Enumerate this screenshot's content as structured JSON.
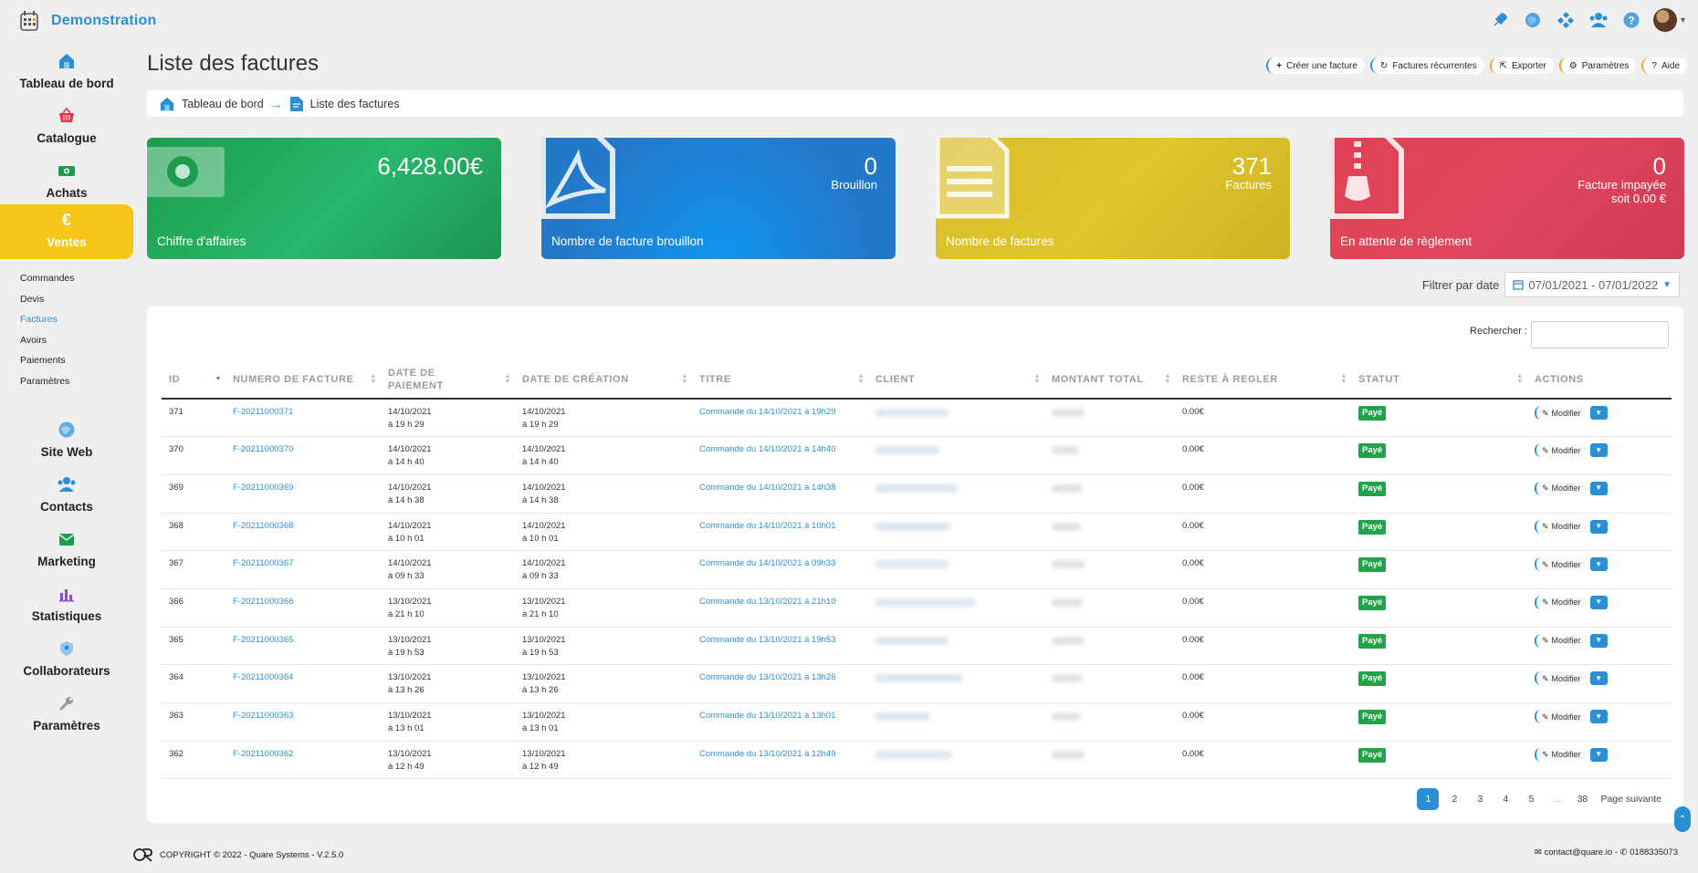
{
  "app": {
    "name": "Demonstration"
  },
  "colors": {
    "accent": "#2b8fd6",
    "active_nav": "#f5c518",
    "paid": "#22a34a"
  },
  "top_icons": [
    "rocket-icon",
    "globe-icon",
    "tasks-icon",
    "users-icon",
    "help-icon"
  ],
  "sidebar": {
    "items": [
      {
        "label": "Tableau de bord",
        "icon": "home-icon"
      },
      {
        "label": "Catalogue",
        "icon": "basket-icon"
      },
      {
        "label": "Achats",
        "icon": "cash-icon"
      },
      {
        "label": "Ventes",
        "icon": "euro-icon"
      },
      {
        "label": "Site Web",
        "icon": "globe-icon"
      },
      {
        "label": "Contacts",
        "icon": "contacts-icon"
      },
      {
        "label": "Marketing",
        "icon": "mail-icon"
      },
      {
        "label": "Statistiques",
        "icon": "stats-icon"
      },
      {
        "label": "Collaborateurs",
        "icon": "shield-icon"
      },
      {
        "label": "Paramètres",
        "icon": "wrench-icon"
      }
    ],
    "subnav": [
      "Commandes",
      "Devis",
      "Factures",
      "Avoirs",
      "Paiements",
      "Paramètres"
    ]
  },
  "page": {
    "title": "Liste des factures"
  },
  "actions": [
    "Créer une facture",
    "Factures récurrentes",
    "Exporter",
    "Paramètres",
    "Aide"
  ],
  "breadcrumb": {
    "home": "Tableau de bord",
    "current": "Liste des factures"
  },
  "cards": {
    "revenue": {
      "value": "6,428.00€",
      "caption": "Chiffre d'affaires"
    },
    "drafts": {
      "value": "0",
      "sub": "Brouillon",
      "caption": "Nombre de facture brouillon"
    },
    "invoices": {
      "value": "371",
      "sub": "Factures",
      "caption": "Nombre de factures"
    },
    "pending": {
      "value": "0",
      "sub1": "Facture impayée",
      "sub2": "soit 0.00 €",
      "caption": "En attente de règlement"
    }
  },
  "filter": {
    "label": "Filtrer par date",
    "range": "07/01/2021 - 07/01/2022"
  },
  "search": {
    "label": "Rechercher :"
  },
  "table": {
    "columns": [
      "ID",
      "NUMERO DE FACTURE",
      "DATE DE PAIEMENT",
      "DATE DE CRÉATION",
      "TITRE",
      "CLIENT",
      "MONTANT TOTAL",
      "RESTE À REGLER",
      "STATUT",
      "ACTIONS"
    ],
    "rows": [
      {
        "id": "371",
        "num": "F-20211000371",
        "pay_d": "14/10/2021",
        "pay_t": "à 19 h 29",
        "cre_d": "14/10/2021",
        "cre_t": "à 19 h 29",
        "title": "Commande du 14/10/2021 à 19h29",
        "rest": "0.00€",
        "status": "Payé"
      },
      {
        "id": "370",
        "num": "F-20211000370",
        "pay_d": "14/10/2021",
        "pay_t": "à 14 h 40",
        "cre_d": "14/10/2021",
        "cre_t": "à 14 h 40",
        "title": "Commande du 14/10/2021 à 14h40",
        "rest": "0.00€",
        "status": "Payé"
      },
      {
        "id": "369",
        "num": "F-20211000369",
        "pay_d": "14/10/2021",
        "pay_t": "à 14 h 38",
        "cre_d": "14/10/2021",
        "cre_t": "à 14 h 38",
        "title": "Commande du 14/10/2021 à 14h38",
        "rest": "0.00€",
        "status": "Payé"
      },
      {
        "id": "368",
        "num": "F-20211000368",
        "pay_d": "14/10/2021",
        "pay_t": "à 10 h 01",
        "cre_d": "14/10/2021",
        "cre_t": "à 10 h 01",
        "title": "Commande du 14/10/2021 à 10h01",
        "rest": "0.00€",
        "status": "Payé"
      },
      {
        "id": "367",
        "num": "F-20211000367",
        "pay_d": "14/10/2021",
        "pay_t": "à 09 h 33",
        "cre_d": "14/10/2021",
        "cre_t": "à 09 h 33",
        "title": "Commande du 14/10/2021 à 09h33",
        "rest": "0.00€",
        "status": "Payé"
      },
      {
        "id": "366",
        "num": "F-20211000366",
        "pay_d": "13/10/2021",
        "pay_t": "à 21 h 10",
        "cre_d": "13/10/2021",
        "cre_t": "à 21 h 10",
        "title": "Commande du 13/10/2021 à 21h10",
        "rest": "0.00€",
        "status": "Payé"
      },
      {
        "id": "365",
        "num": "F-20211000365",
        "pay_d": "13/10/2021",
        "pay_t": "à 19 h 53",
        "cre_d": "13/10/2021",
        "cre_t": "à 19 h 53",
        "title": "Commande du 13/10/2021 à 19h53",
        "rest": "0.00€",
        "status": "Payé"
      },
      {
        "id": "364",
        "num": "F-20211000364",
        "pay_d": "13/10/2021",
        "pay_t": "à 13 h 26",
        "cre_d": "13/10/2021",
        "cre_t": "à 13 h 26",
        "title": "Commande du 13/10/2021 à 13h26",
        "rest": "0.00€",
        "status": "Payé"
      },
      {
        "id": "363",
        "num": "F-20211000363",
        "pay_d": "13/10/2021",
        "pay_t": "à 13 h 01",
        "cre_d": "13/10/2021",
        "cre_t": "à 13 h 01",
        "title": "Commande du 13/10/2021 à 13h01",
        "rest": "0.00€",
        "status": "Payé"
      },
      {
        "id": "362",
        "num": "F-20211000362",
        "pay_d": "13/10/2021",
        "pay_t": "à 12 h 49",
        "cre_d": "13/10/2021",
        "cre_t": "à 12 h 49",
        "title": "Commande du 13/10/2021 à 12h49",
        "rest": "0.00€",
        "status": "Payé"
      }
    ],
    "modify_label": "Modifier"
  },
  "pagination": {
    "pages": [
      "1",
      "2",
      "3",
      "4",
      "5",
      "...",
      "38"
    ],
    "next": "Page suivante"
  },
  "footer": {
    "copyright": "COPYRIGHT © 2022 - Quare Systems - V.2.5.0",
    "contact": "✉ contact@quare.io - ✆ 0188335073"
  }
}
